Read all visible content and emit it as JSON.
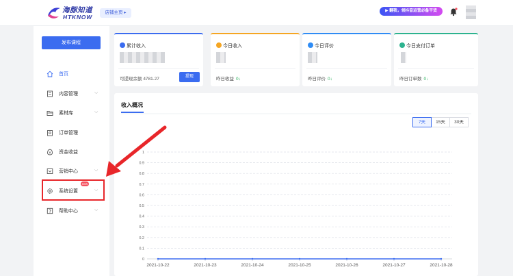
{
  "header": {
    "logo_cn": "海豚知道",
    "logo_en": "HTKNOW",
    "shop_home": "店铺主页 ▸",
    "promo": "▶ 翻我，领抖音运营必备干货"
  },
  "sidebar": {
    "publish": "发布课程",
    "items": [
      {
        "label": "首页",
        "icon": "home-icon",
        "active": true
      },
      {
        "label": "内容管理",
        "icon": "content-icon",
        "chevron": true
      },
      {
        "label": "素材库",
        "icon": "folder-icon",
        "chevron": true
      },
      {
        "label": "订单管理",
        "icon": "order-icon"
      },
      {
        "label": "资金收益",
        "icon": "money-icon"
      },
      {
        "label": "营销中心",
        "icon": "marketing-icon",
        "chevron": true
      },
      {
        "label": "系统设置",
        "icon": "gear-icon",
        "chevron": true,
        "badge": "new"
      },
      {
        "label": "帮助中心",
        "icon": "help-icon",
        "chevron": true
      }
    ]
  },
  "stats": [
    {
      "title": "累计收入",
      "foot_label": "可提现余额",
      "foot_value": "4781.27",
      "action": "提现",
      "color": "#3b6cf0",
      "icon": "income-icon"
    },
    {
      "title": "今日收入",
      "foot_label": "昨日收益",
      "foot_value": "0",
      "color": "#f5a623",
      "icon": "today-income-icon"
    },
    {
      "title": "今日评价",
      "foot_label": "昨日评价",
      "foot_value": "0",
      "color": "#2f8cf5",
      "icon": "review-icon"
    },
    {
      "title": "今日支付订单",
      "foot_label": "昨日订单数",
      "foot_value": "0",
      "color": "#2db38f",
      "icon": "order-paid-icon"
    }
  ],
  "trend_arrow": "↓",
  "chart_panel": {
    "title": "收入概况",
    "ranges": [
      {
        "label": "7天",
        "active": true
      },
      {
        "label": "15天"
      },
      {
        "label": "30天"
      }
    ]
  },
  "chart_data": {
    "type": "line",
    "title": "",
    "xlabel": "",
    "ylabel": "",
    "categories": [
      "2021-10-22",
      "2021-10-23",
      "2021-10-24",
      "2021-10-25",
      "2021-10-26",
      "2021-10-27",
      "2021-10-28"
    ],
    "series": [
      {
        "values": [
          0,
          0,
          0,
          0,
          0,
          0,
          0
        ],
        "color": "#3b6cf0"
      }
    ],
    "ylim": [
      0,
      1
    ],
    "yticks": [
      "0",
      "0.1",
      "0.2",
      "0.3",
      "0.4",
      "0.5",
      "0.6",
      "0.7",
      "0.8",
      "0.9",
      "1"
    ],
    "grid": true,
    "legend": "none"
  },
  "annotation": {
    "arrow_color": "#e8262a",
    "box_target": "系统设置"
  }
}
